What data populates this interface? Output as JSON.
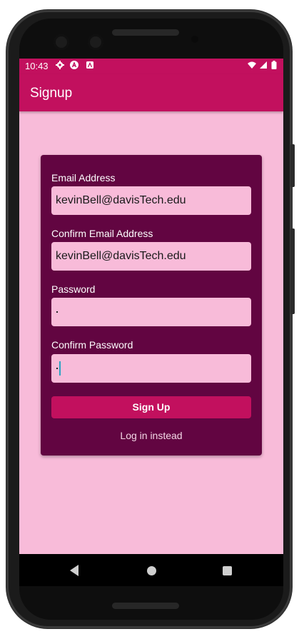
{
  "status_bar": {
    "time": "10:43",
    "icons": [
      "settings-icon",
      "app-icon",
      "notification-icon",
      "wifi-icon",
      "signal-icon",
      "battery-icon"
    ]
  },
  "app_bar": {
    "title": "Signup"
  },
  "form": {
    "email_label": "Email Address",
    "email_value": "kevinBell@davisTech.edu",
    "confirm_email_label": "Confirm Email Address",
    "confirm_email_value": "kevinBell@davisTech.edu",
    "password_label": "Password",
    "confirm_password_label": "Confirm Password",
    "signup_button": "Sign Up",
    "login_link": "Log in instead"
  },
  "nav_bar": {
    "buttons": [
      "back-icon",
      "home-icon",
      "recents-icon"
    ]
  },
  "colors": {
    "primary": "#c2105e",
    "card": "#620541",
    "background": "#f8bbd9"
  }
}
